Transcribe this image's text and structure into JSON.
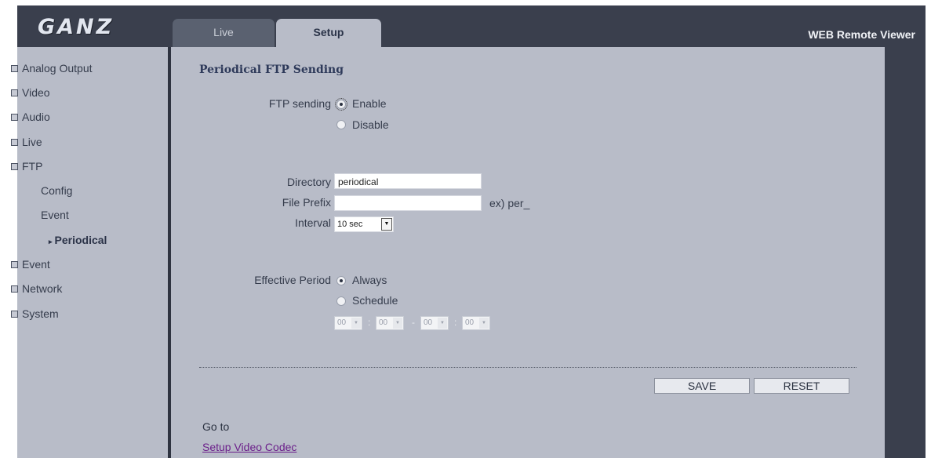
{
  "header": {
    "logo_text": "GANZ",
    "app_title": "WEB Remote Viewer",
    "tabs": [
      {
        "label": "Live",
        "active": false
      },
      {
        "label": "Setup",
        "active": true
      }
    ]
  },
  "sidebar": {
    "items": [
      {
        "label": "Analog Output"
      },
      {
        "label": "Video"
      },
      {
        "label": "Audio"
      },
      {
        "label": "Live"
      },
      {
        "label": "FTP"
      },
      {
        "label": "Event"
      },
      {
        "label": "Network"
      },
      {
        "label": "System"
      }
    ],
    "ftp_children": [
      {
        "label": "Config",
        "active": false
      },
      {
        "label": "Event",
        "active": false
      },
      {
        "label": "Periodical",
        "active": true
      }
    ]
  },
  "main": {
    "section_title": "Periodical FTP Sending",
    "ftp_sending": {
      "label": "FTP sending",
      "options": [
        "Enable",
        "Disable"
      ],
      "selected": "Enable"
    },
    "directory": {
      "label": "Directory",
      "value": "periodical"
    },
    "file_prefix": {
      "label": "File Prefix",
      "value": "",
      "hint": "ex) per_"
    },
    "interval": {
      "label": "Interval",
      "value": "10 sec"
    },
    "effective_period": {
      "label": "Effective Period",
      "options": [
        "Always",
        "Schedule"
      ],
      "selected": "Always",
      "schedule": {
        "start_hour": "00",
        "start_minute": "00",
        "end_hour": "00",
        "end_minute": "00",
        "time_sep": ":",
        "range_sep": "-",
        "enabled": false
      }
    },
    "buttons": {
      "save": "SAVE",
      "reset": "RESET"
    },
    "goto_label": "Go to",
    "goto_link": "Setup Video Codec"
  },
  "colors": {
    "frame": "#3a3f4d",
    "panel": "#b8bcc8",
    "link": "#6b1f8a"
  }
}
